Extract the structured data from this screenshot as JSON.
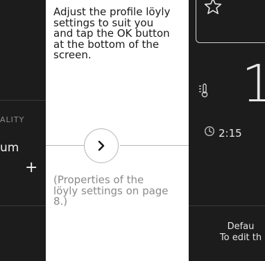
{
  "left_panel": {
    "quality_label": "ALITY",
    "quality_value": "um",
    "plus_glyph": "+"
  },
  "center": {
    "instruction": "Adjust the profile löyly settings to suit you and tap the OK button at the bottom of the screen.",
    "next_icon": "chevron-right-icon",
    "footnote": "(Properties of the löyly settings on page 8.)"
  },
  "right_panel": {
    "favorite_icon": "star-outline-icon",
    "thermometer_icon": "thermometer-icon",
    "temperature_value": "1",
    "timer_icon": "timer-icon",
    "time_value": "2:15",
    "default_line1": "Defau",
    "default_line2": "To edit th"
  },
  "colors": {
    "dark_panel": "#1c1c1c",
    "light_text": "#e6e6e6",
    "muted_text": "#8a8a8a",
    "rule": "#b7b7b7"
  }
}
